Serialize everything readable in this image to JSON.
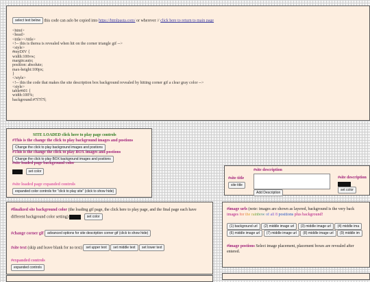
{
  "code_box": {
    "select_button": "select text below",
    "copy_text": "this code can aslo be copied into",
    "copy_link": "https://htmlpasta.com/",
    "copy_mid": "or wherever //",
    "return_link": "click here to return to main page",
    "code_lines": [
      "<html>",
      "<head>",
      "<title></title>",
      "<!-- this is therea is revealed when hit on the corner triangle gif -->",
      "<style>",
      "#myDIV {",
      "width:100vw;",
      "margin:auto;",
      "position: absolute;",
      "max-height:100px;",
      "}",
      "</style>",
      "<!-- this the code that makes the site description box background revealed by hitting corner gif a clear gray color -->",
      "<style>",
      "table#t01 {",
      "width:100%;",
      "background:#7f7f7f;"
    ]
  },
  "controls_box": {
    "site_loaded": "SITE LOADED click here to play page controls",
    "change_bg_heading": "#This is the change the click to play background images and postions",
    "change_bg_button": "Change the click to play background images and postions",
    "change_box_heading": "#This is the change the click to play BOX images and postions",
    "change_box_button": "Change the click to play BOX background images and postions",
    "bg_color_heading": "#site loaded page background color",
    "set_color_button": "set color",
    "expanded_heading": "#site loaded page expanded controls",
    "expanded_button": "expanded color controls for \"click to play site\" (click to show hide)",
    "swatch_color": "#111111"
  },
  "site_box": {
    "title_label": "#site title",
    "title_button": "site title",
    "description_label": "#site description",
    "add_description_button": "Add Description",
    "description_label_right": "#site description",
    "set_color_button": "set color"
  },
  "finalized_box": {
    "bg_heading": "#finalized site background color",
    "bg_text": "(the loading gif page, the click here to play page, and the final page each have different background color setting)",
    "set_color_button": "set color",
    "corner_heading": "#change corner gif",
    "corner_button": "advanced options for site description corner gif (click to show hide)",
    "site_text_heading": "#site text",
    "site_text_note": "(skip and leave blank for no text)",
    "set_upper_button": "set upper text",
    "set_middle_button": "set middle text",
    "set_lower_button": "set lower text",
    "expanded_heading": "#expanded controls",
    "expanded_button": "expanded controls"
  },
  "images_box": {
    "urls_heading": "#image urls",
    "urls_text": "(note: images are shown as layered, background is the very back",
    "urls_text2_a": "images",
    "urls_text2_rainbow": "for the rainbow of all 8",
    "urls_text2_b": "positions",
    "urls_text2_c": "plus background!",
    "url_buttons_row1": [
      "(1) background url",
      "(2) middle image url",
      "(3) middle image url",
      "(4) middle ima"
    ],
    "url_buttons_row2": [
      "(6) middle image url",
      "(7) middle image url",
      "(8) middle image url",
      "(9) middle im"
    ],
    "positions_heading": "#image postions",
    "positions_text": "Select image placement, placement boxes are revealed after",
    "positions_text2": "entered."
  }
}
